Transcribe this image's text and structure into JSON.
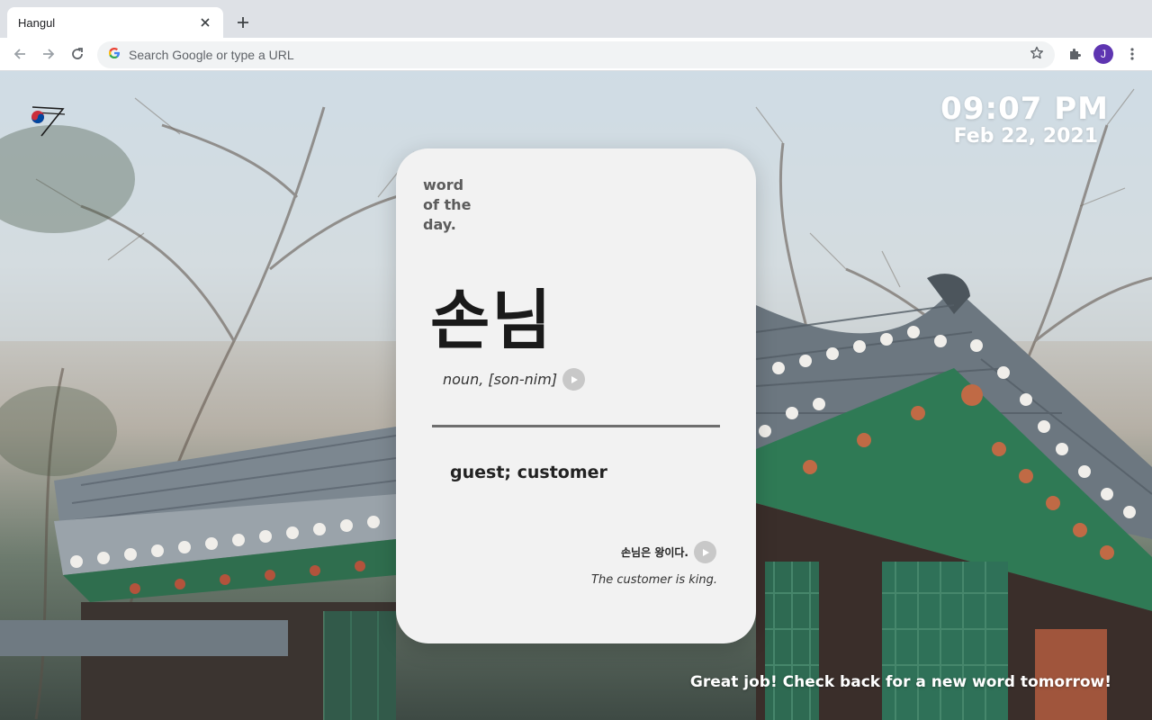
{
  "browser": {
    "tab_title": "Hangul",
    "omnibox_placeholder": "Search Google or type a URL",
    "profile_initial": "J"
  },
  "clock": {
    "time": "09:07 PM",
    "date": "Feb 22, 2021"
  },
  "card": {
    "heading_lines": [
      "word",
      "of the",
      "day."
    ],
    "word": "손님",
    "pronunciation": "noun, [son-nim]",
    "meaning": "guest; customer",
    "example_korean": "손님은 왕이다.",
    "example_translation": "The customer is king."
  },
  "footer": {
    "message": "Great job! Check back for a new word tomorrow!"
  },
  "colors": {
    "card_bg": "#f2f2f2",
    "play_button": "#c8c8c8",
    "avatar": "#5e35b1"
  }
}
